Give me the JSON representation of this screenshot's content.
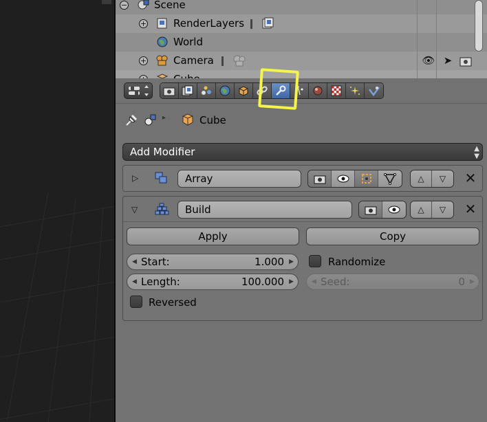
{
  "outliner": {
    "rows": [
      {
        "label": "Scene",
        "icon": "scene-icon"
      },
      {
        "label": "RenderLayers",
        "icon": "render-layers-icon"
      },
      {
        "label": "World",
        "icon": "world-icon"
      },
      {
        "label": "Camera",
        "icon": "camera-object-icon"
      },
      {
        "label": "Cube",
        "icon": "mesh-object-icon"
      }
    ]
  },
  "properties": {
    "tabs": [
      "render-tab",
      "render-layers-tab",
      "scene-tab",
      "world-tab",
      "object-tab",
      "constraints-tab",
      "modifiers-tab",
      "data-tab",
      "material-tab",
      "texture-tab",
      "particles-tab",
      "physics-tab"
    ],
    "active_tab": "modifiers-tab",
    "breadcrumb": {
      "object_name": "Cube"
    },
    "add_modifier_label": "Add Modifier",
    "modifiers": [
      {
        "name": "Array",
        "collapsed": true
      },
      {
        "name": "Build",
        "collapsed": false
      }
    ],
    "build": {
      "apply_label": "Apply",
      "copy_label": "Copy",
      "start_label": "Start:",
      "start_value": "1.000",
      "length_label": "Length:",
      "length_value": "100.000",
      "randomize_label": "Randomize",
      "seed_label": "Seed:",
      "seed_value": "0",
      "reversed_label": "Reversed"
    }
  },
  "colors": {
    "active_tab": "#4f77b5",
    "highlight": "#f4f44a",
    "panel_bg": "#727272",
    "outliner_bg": "#8f8f8f"
  }
}
